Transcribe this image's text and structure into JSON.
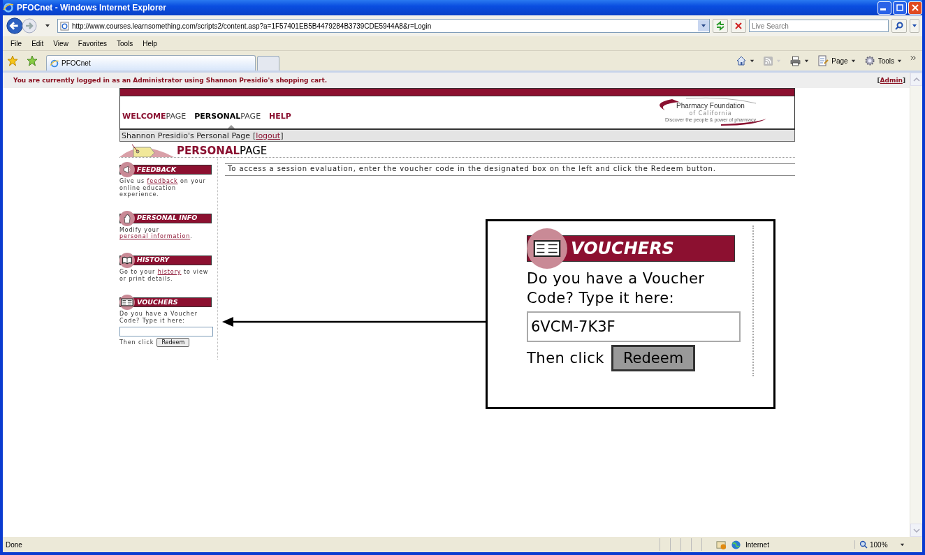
{
  "window": {
    "title": "PFOCnet - Windows Internet Explorer"
  },
  "address": {
    "url": "http://www.courses.learnsomething.com/scripts2/content.asp?a=1F57401EB5B4479284B3739CDE5944A8&r=Login"
  },
  "search": {
    "placeholder": "Live Search"
  },
  "menu": [
    "File",
    "Edit",
    "View",
    "Favorites",
    "Tools",
    "Help"
  ],
  "tabs": [
    {
      "label": "PFOCnet",
      "selected": true
    }
  ],
  "command_bar": [
    {
      "kind": "home"
    },
    {
      "kind": "feeds"
    },
    {
      "kind": "print"
    },
    {
      "kind": "page",
      "label": "Page"
    },
    {
      "kind": "tools",
      "label": "Tools"
    }
  ],
  "admin_bar": {
    "notice": "You are currently logged in as an Administrator using Shannon Presidio's shopping cart.",
    "open": "[",
    "link": "Admin",
    "close": "]"
  },
  "site_nav": [
    {
      "label": "**WELCOME**PAGE",
      "selected": false
    },
    {
      "label": "**PERSONAL**PAGE",
      "selected": true
    },
    {
      "label": "**HELP**",
      "selected": false
    }
  ],
  "logo": {
    "name": "Pharmacy Foundation",
    "sub": "of California",
    "tagline": "Discover the people & power of pharmacy"
  },
  "user_bar": {
    "text": "Shannon Presidio's Personal Page",
    "open": "[",
    "link": "logout",
    "close": "]"
  },
  "page_heading": "**PERSONAL**PAGE",
  "sidebar": [
    {
      "kind": "feedback",
      "title": "FEEDBACK",
      "before": "Give us ",
      "link": "feedback",
      "after": " on your online education experience."
    },
    {
      "kind": "personal",
      "title": "PERSONAL INFO",
      "before": "Modify your ",
      "link": "personal information",
      "after": "."
    },
    {
      "kind": "history",
      "title": "HISTORY",
      "before": "Go to your ",
      "link": "history",
      "after": " to view or print details."
    },
    {
      "kind": "vouchers",
      "title": "VOUCHERS",
      "prompt": "Do you have a Voucher Code? Type it here:",
      "then": "Then click",
      "button": "Redeem"
    }
  ],
  "instruction": "To access a session evaluation, enter the voucher code in the designated box on the left and click the Redeem button.",
  "callout": {
    "title": "VOUCHERS",
    "prompt": "Do you have a Voucher Code? Type it here:",
    "value": "6VCM-7K3F",
    "then": "Then click",
    "button": "Redeem"
  },
  "status_bar": {
    "text": "Done",
    "zone": "Internet",
    "zoom": "100%"
  }
}
